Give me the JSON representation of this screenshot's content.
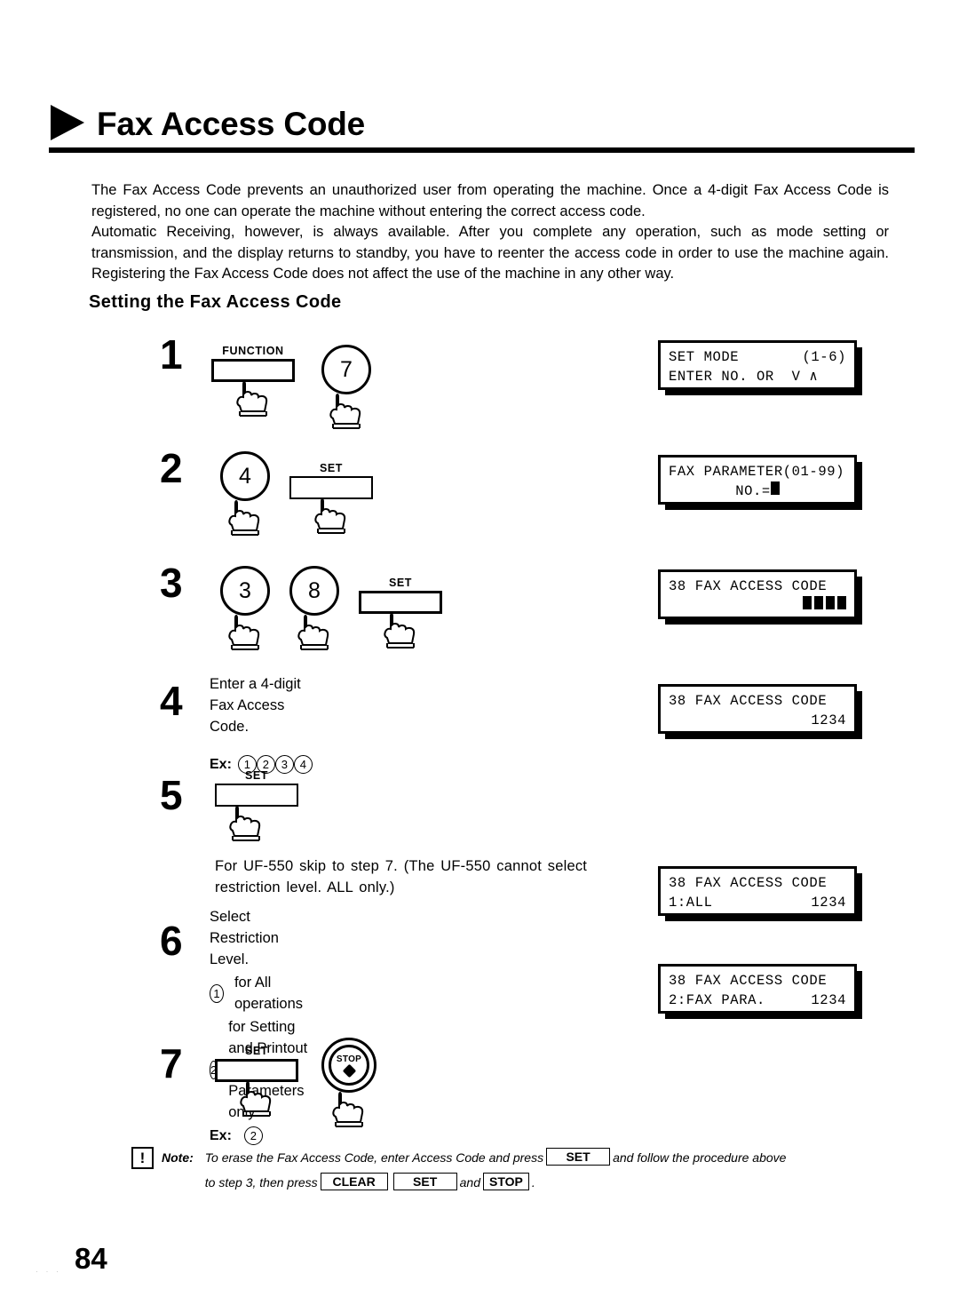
{
  "heading": {
    "title": "Fax Access Code",
    "marker": "triangle-right"
  },
  "intro": {
    "line1": "The Fax Access Code prevents an unauthorized user from operating the machine.  Once a 4-digit Fax Access Code is registered, no one can operate the machine without entering the correct access code.",
    "line2": "Automatic Receiving, however, is always available.  After you complete any operation, such as mode setting or transmission, and the display returns to standby, you have to reenter the access code in order to use the machine again.  Registering the Fax Access Code does not affect the use of the machine in any other way."
  },
  "subheading": "Setting the Fax Access Code",
  "steps": {
    "s1": {
      "num": "1",
      "keys": {
        "function_label": "FUNCTION",
        "digit": "7"
      }
    },
    "s2": {
      "num": "2",
      "keys": {
        "digit": "4",
        "set_label": "SET"
      }
    },
    "s3": {
      "num": "3",
      "keys": {
        "digit1": "3",
        "digit2": "8",
        "set_label": "SET"
      }
    },
    "s4": {
      "num": "4",
      "text": "Enter a 4-digit Fax Access Code.",
      "ex_label": "Ex:",
      "ex_digits": [
        "1",
        "2",
        "3",
        "4"
      ]
    },
    "s5": {
      "num": "5",
      "keys": {
        "set_label": "SET"
      },
      "text": "For UF-550 skip to step 7. (The UF-550 cannot select restriction level. ALL only.)"
    },
    "s6": {
      "num": "6",
      "title": "Select Restriction Level.",
      "option1_digit": "1",
      "option1_text": "for All operations",
      "option2_digit": "2",
      "option2_text": "for Setting and Printout of Fax Parameters only.",
      "ex_label": "Ex:",
      "ex_digit": "2"
    },
    "s7": {
      "num": "7",
      "keys": {
        "set_label": "SET",
        "stop_label": "STOP"
      }
    }
  },
  "displays": {
    "d1": {
      "l1_left": "SET MODE",
      "l1_right": "(1-6)",
      "l2": "ENTER NO. OR  V ∧"
    },
    "d2": {
      "l1": "FAX PARAMETER(01-99)",
      "l2": "NO.="
    },
    "d3": {
      "l1": "38 FAX ACCESS CODE",
      "l2_blocks": 4
    },
    "d4": {
      "l1": "38 FAX ACCESS CODE",
      "l2": "1234"
    },
    "d5": {
      "l1": "38 FAX ACCESS CODE",
      "l2_left": "1:ALL",
      "l2_right": "1234"
    },
    "d6": {
      "l1": "38 FAX ACCESS CODE",
      "l2_left": "2:FAX PARA.",
      "l2_right": "1234"
    }
  },
  "note": {
    "icon": "!",
    "label": "Note:",
    "part1": "To erase the Fax Access Code, enter Access Code and press",
    "key1": "SET",
    "part2": "and follow the procedure above",
    "part3": "to step 3, then press",
    "key2": "CLEAR",
    "key3": "SET",
    "part4": "and",
    "key4": "STOP",
    "part5": "."
  },
  "page_number": "84"
}
